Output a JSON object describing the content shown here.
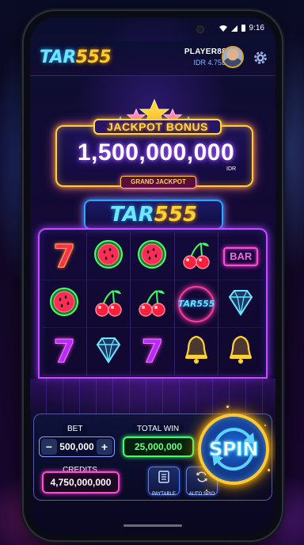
{
  "status_bar": {
    "time": "9:16"
  },
  "header": {
    "logo_part1": "TAR",
    "logo_part2": "555",
    "player_name": "PLAYER88",
    "player_balance": "IDR 4.75B"
  },
  "jackpot": {
    "title": "JACKPOT BONUS",
    "amount": "1,500,000,000",
    "currency": "IDR",
    "subtitle": "GRAND JACKPOT"
  },
  "machine": {
    "title_part1": "TAR",
    "title_part2": "555"
  },
  "reels": {
    "rows": [
      [
        "red-seven",
        "watermelon",
        "watermelon",
        "cherries",
        "bar"
      ],
      [
        "watermelon",
        "cherries",
        "cherries",
        "tar555-coin",
        "diamond"
      ],
      [
        "pink-seven",
        "diamond",
        "pink-seven",
        "bell",
        "bell"
      ]
    ],
    "bar_label": "BAR",
    "coin_label": "TAR555",
    "seven_label": "7"
  },
  "controls": {
    "bet_label": "BET",
    "bet_value": "500,000",
    "minus_label": "−",
    "plus_label": "+",
    "total_win_label": "TOTAL WIN",
    "total_win_value": "25,000,000",
    "credits_label": "CREDITS",
    "credits_value": "4,750,000,000",
    "paytable_label": "PAYTABLE",
    "auto_spin_label": "AUTO SPIO",
    "spin_label": "SPIN"
  },
  "colors": {
    "accent_gold": "#ffcf3a",
    "accent_cyan": "#6fe4ff",
    "win_green": "#3cff6a",
    "credits_pink": "#ff4ad6",
    "spin_blue": "#1a6ad8"
  }
}
